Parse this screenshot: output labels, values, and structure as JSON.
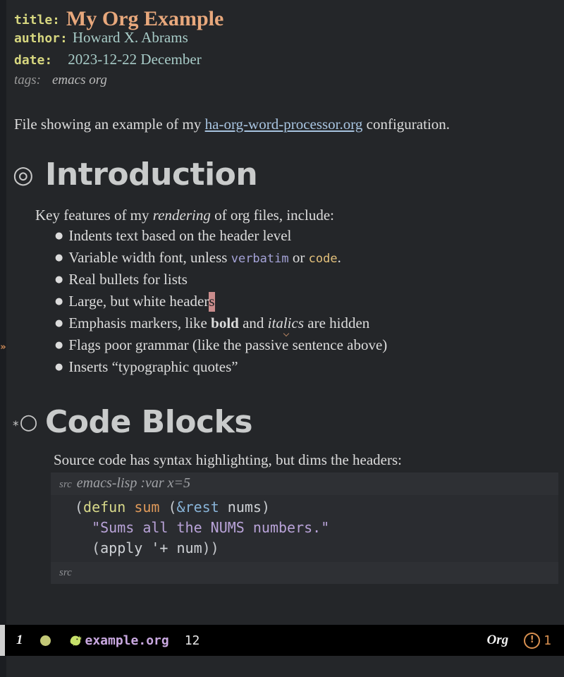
{
  "document": {
    "keywords": [
      {
        "name": "title",
        "label": "title:",
        "value": "My Org Example"
      },
      {
        "name": "author",
        "label": "author:",
        "value": "Howard X. Abrams"
      },
      {
        "name": "date",
        "label": "date:",
        "value": "2023-12-22 December"
      },
      {
        "name": "tags",
        "label": "tags:",
        "value": "emacs org"
      }
    ],
    "intro_paragraph": {
      "before_link": "File showing an example of my ",
      "link_text": "ha-org-word-processor.org",
      "after_link": " configuration."
    },
    "sections": [
      {
        "bullet": "◎",
        "heading": "Introduction",
        "lead": {
          "part1": "Key features of my ",
          "emphasis": "rendering",
          "part2": " of org files, include:"
        },
        "items": [
          {
            "text": "Indents text based on the header level"
          },
          {
            "prefix": "Variable width font, unless ",
            "verbatim": "verbatim",
            "middle": " or ",
            "code": "code",
            "suffix": "."
          },
          {
            "text": "Real bullets for lists"
          },
          {
            "prefix": "Large, but white header",
            "cursor": "s"
          },
          {
            "prefix": "Emphasis markers, like ",
            "bold": "bold",
            "middle": " and ",
            "italic": "italics",
            "suffix": " are hidden"
          },
          {
            "text": "Flags poor grammar (like the passive sentence above)"
          },
          {
            "text": "Inserts “typographic quotes”"
          }
        ]
      },
      {
        "bullet_star": "*",
        "bullet": "○",
        "heading": "Code Blocks",
        "lead_text": "Source code has syntax highlighting, but dims the headers:",
        "code_block": {
          "begin_keyword": "src",
          "begin_args": "emacs-lisp :var x=5",
          "end_keyword": "src",
          "lines": [
            [
              {
                "t": "(",
                "c": "paren"
              },
              {
                "t": "defun",
                "c": "kw"
              },
              {
                "t": " ",
                "c": "var"
              },
              {
                "t": "sum",
                "c": "fn"
              },
              {
                "t": " (",
                "c": "paren"
              },
              {
                "t": "&rest",
                "c": "amp"
              },
              {
                "t": " ",
                "c": "var"
              },
              {
                "t": "nums",
                "c": "var"
              },
              {
                "t": ")",
                "c": "paren"
              }
            ],
            [
              {
                "t": "  ",
                "c": "var"
              },
              {
                "t": "\"Sums all the NUMS numbers.\"",
                "c": "str"
              }
            ],
            [
              {
                "t": "  (",
                "c": "paren"
              },
              {
                "t": "apply",
                "c": "var"
              },
              {
                "t": " ",
                "c": "var"
              },
              {
                "t": "'+",
                "c": "var"
              },
              {
                "t": " ",
                "c": "var"
              },
              {
                "t": "num",
                "c": "var"
              },
              {
                "t": "))",
                "c": "paren"
              }
            ]
          ]
        }
      }
    ],
    "fringe_marker": "»"
  },
  "modeline": {
    "window_number": "1",
    "buffer_name": "example.org",
    "column": "12",
    "major_mode": "Org",
    "warning_glyph": "!",
    "warning_count": "1"
  }
}
